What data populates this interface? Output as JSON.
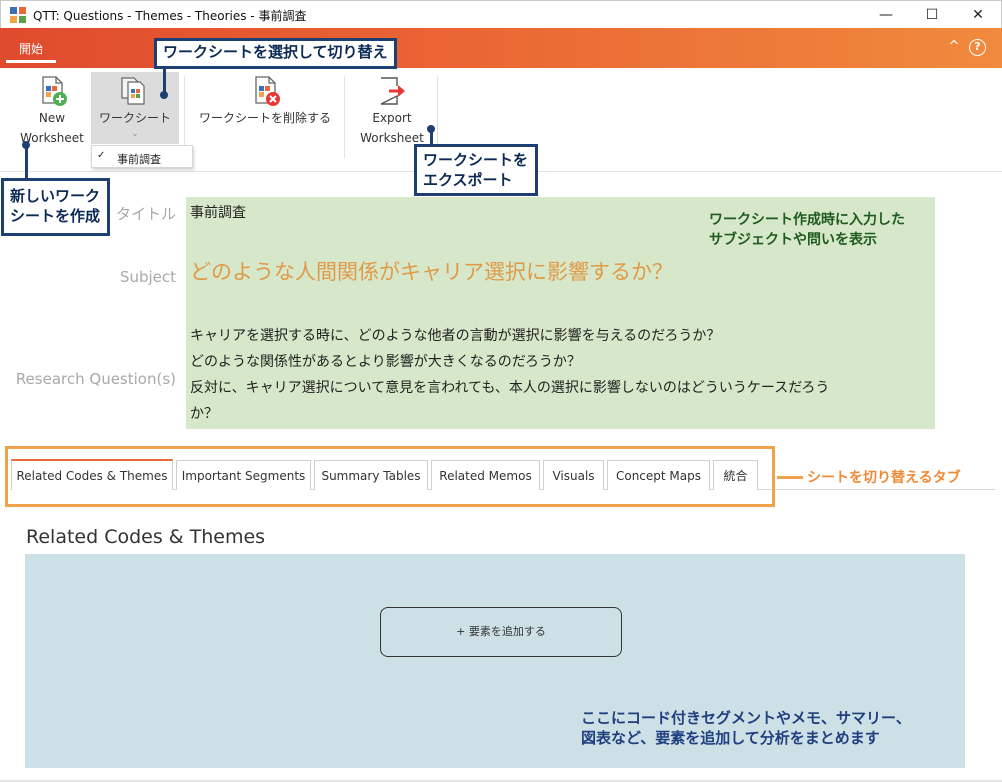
{
  "window": {
    "title": "QTT: Questions - Themes - Theories - 事前調査",
    "minimize_glyph": "—",
    "maximize_glyph": "☐",
    "close_glyph": "✕"
  },
  "ribbon": {
    "tab_label": "開始",
    "collapse_glyph": "^",
    "help_glyph": "?"
  },
  "toolbar": {
    "new_worksheet": {
      "line1": "New",
      "line2": "Worksheet"
    },
    "worksheets": {
      "label": "ワークシート",
      "chevron": "⌄"
    },
    "delete_worksheet": {
      "label": "ワークシートを削除する"
    },
    "export_worksheet": {
      "line1": "Export",
      "line2": "Worksheet"
    },
    "dropdown": {
      "check": "✓",
      "item": "事前調査"
    }
  },
  "callouts": {
    "switch_worksheet": "ワークシートを選択して切り替え",
    "new_worksheet_l1": "新しいワーク",
    "new_worksheet_l2": "シートを作成",
    "export_l1": "ワークシートを",
    "export_l2": "エクスポート"
  },
  "fields": {
    "title_label": "タイトル",
    "title_value": "事前調査",
    "subject_label": "Subject",
    "subject_value": "どのような人間関係がキャリア選択に影響するか？",
    "rq_label": "Research Question(s)",
    "rq_lines": [
      "キャリアを選択する時に、どのような他者の言動が選択に影響を与えるのだろうか？",
      "どのような関係性があるとより影響が大きくなるのだろうか？",
      "反対に、キャリア選択について意見を言われても、本人の選択に影響しないのはどういうケースだろう",
      "か？"
    ],
    "note_l1": "ワークシート作成時に入力した",
    "note_l2": "サブジェクトや問いを表示"
  },
  "tabs": [
    {
      "label": "Related Codes & Themes",
      "active": true
    },
    {
      "label": "Important Segments",
      "active": false
    },
    {
      "label": "Summary Tables",
      "active": false
    },
    {
      "label": "Related Memos",
      "active": false
    },
    {
      "label": "Visuals",
      "active": false
    },
    {
      "label": "Concept Maps",
      "active": false
    },
    {
      "label": "統合",
      "active": false
    }
  ],
  "tabs_note": "シートを切り替えるタブ",
  "content": {
    "section_title": "Related Codes & Themes",
    "add_element_button": "+ 要素を追加する",
    "note_l1": "ここにコード付きセグメントやメモ、サマリー、",
    "note_l2": "図表など、要素を追加して分析をまとめます"
  },
  "colors": {
    "ribbon_start": "#e04a2e",
    "ribbon_end": "#f08a3e",
    "callout_border": "#1e3f73",
    "header_panel": "#d6e8c9",
    "subject_text": "#e09a48",
    "tabs_frame": "#f0a24a",
    "content_panel": "#cde0e5"
  }
}
